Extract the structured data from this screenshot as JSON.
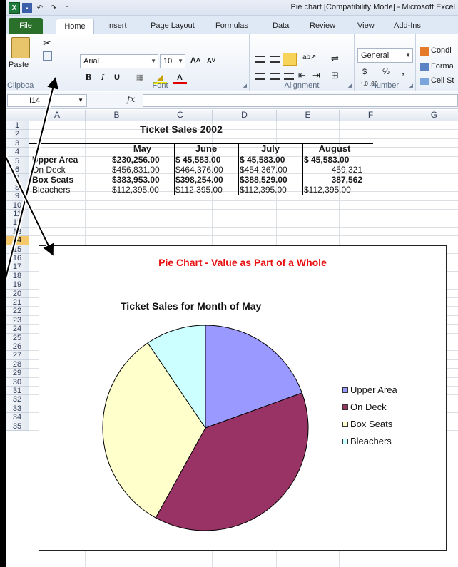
{
  "window": {
    "title": "Pie chart  [Compatibility Mode]  -  Microsoft Excel"
  },
  "qat": {
    "logo": "X",
    "save": "▪",
    "undo": "↶",
    "redo": "↷",
    "customize": "⁼"
  },
  "tabs": {
    "file": "File",
    "home": "Home",
    "insert": "Insert",
    "page_layout": "Page Layout",
    "formulas": "Formulas",
    "data": "Data",
    "review": "Review",
    "view": "View",
    "addins": "Add-Ins"
  },
  "ribbon": {
    "clipboard": {
      "label": "Clipboa",
      "paste": "Paste",
      "cut": "✂"
    },
    "font": {
      "label": "Font",
      "name": "Arial",
      "size": "10",
      "grow": "A˄",
      "shrink": "A˅",
      "bold": "B",
      "italic": "I",
      "underline": "U",
      "borders": "▦",
      "fill": "◢",
      "color": "A"
    },
    "alignment": {
      "label": "Alignment",
      "orient": "ab↗",
      "wrap": "⇌",
      "merge": "⊞",
      "indent_dec": "⇤",
      "indent_inc": "⇥"
    },
    "number": {
      "label": "Number",
      "format": "General",
      "currency": "$",
      "percent": "%",
      "comma": ",",
      "inc_dec": "⁺.0 .00",
      "dec_dec": ".00 →.0"
    },
    "styles": {
      "conditional": "Condi",
      "format_as": "Forma",
      "cell_styles": "Cell St"
    }
  },
  "formula_bar": {
    "name_box": "I14",
    "fx": "fx",
    "value": ""
  },
  "columns": [
    "A",
    "B",
    "C",
    "D",
    "E",
    "F",
    "G"
  ],
  "rows": [
    "1",
    "2",
    "3",
    "4",
    "5",
    "6",
    "7",
    "8",
    "9",
    "10",
    "11",
    "12",
    "13",
    "14",
    "15",
    "16",
    "17",
    "18",
    "19",
    "20",
    "21",
    "22",
    "23",
    "24",
    "25",
    "26",
    "27",
    "28",
    "29",
    "30",
    "31",
    "32",
    "33",
    "34",
    "35"
  ],
  "selected_row": "14",
  "sheet": {
    "title": "Ticket Sales 2002",
    "headers": [
      "May",
      "June",
      "July",
      "August"
    ],
    "rows": [
      {
        "label": "Upper Area",
        "bold": true,
        "values": [
          "$230,256.00",
          "$ 45,583.00",
          "$ 45,583.00",
          "$ 45,583.00"
        ]
      },
      {
        "label": "On Deck",
        "bold": false,
        "values": [
          "$456,831.00",
          "$464,376.00",
          "$454,367.00",
          "459,321"
        ]
      },
      {
        "label": "Box Seats",
        "bold": true,
        "values": [
          "$383,953.00",
          "$398,254.00",
          "$388,529.00",
          "387,562"
        ]
      },
      {
        "label": "Bleachers",
        "bold": false,
        "values": [
          "$112,395.00",
          "$112,395.00",
          "$112,395.00",
          "$112,395.00"
        ]
      }
    ]
  },
  "chart": {
    "title": "Pie Chart - Value as Part of a Whole",
    "subtitle": "Ticket Sales for Month of May",
    "title_color": "#E81010"
  },
  "chart_data": {
    "type": "pie",
    "categories": [
      "Upper Area",
      "On Deck",
      "Box Seats",
      "Bleachers"
    ],
    "values": [
      230256,
      456831,
      383953,
      112395
    ],
    "colors": [
      "#9999FF",
      "#993366",
      "#FFFFCC",
      "#CCFFFF"
    ],
    "title": "Ticket Sales for Month of May",
    "legend": "right"
  }
}
